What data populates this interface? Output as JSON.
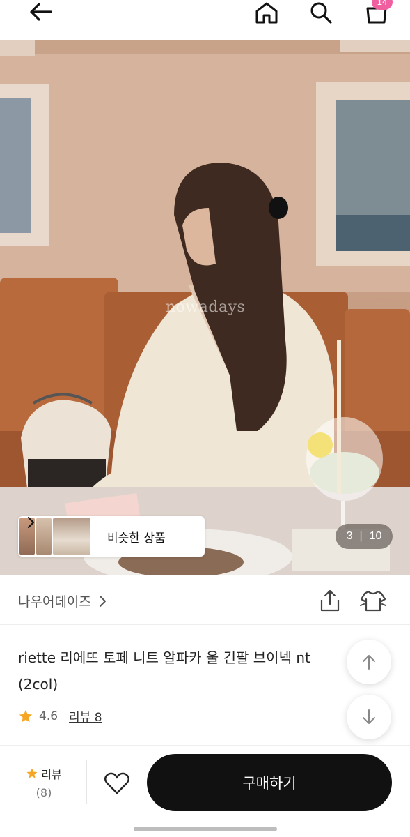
{
  "nav": {
    "back_icon": "arrow-left-icon",
    "home_icon": "home-icon",
    "search_icon": "search-icon",
    "cart_icon": "shopping-bag-icon",
    "cart_count": "14",
    "badge_color": "#f05fa0"
  },
  "gallery": {
    "watermark": "nowadays",
    "similar_label": "비슷한 상품",
    "current": "3",
    "total": "10"
  },
  "brand": {
    "name": "나우어데이즈",
    "share_icon": "share-icon",
    "compare_icon": "clothing-icon"
  },
  "product": {
    "title": "riette 리에뜨 토페 니트 알파카 울 긴팔 브이넥 nt (2col)",
    "rating": "4.6",
    "reviews_link": "리뷰 8",
    "star_color": "#f5a623"
  },
  "bottom": {
    "review_label": "리뷰",
    "review_count": "(8)",
    "wishlist_icon": "heart-icon",
    "buy_label": "구매하기"
  }
}
